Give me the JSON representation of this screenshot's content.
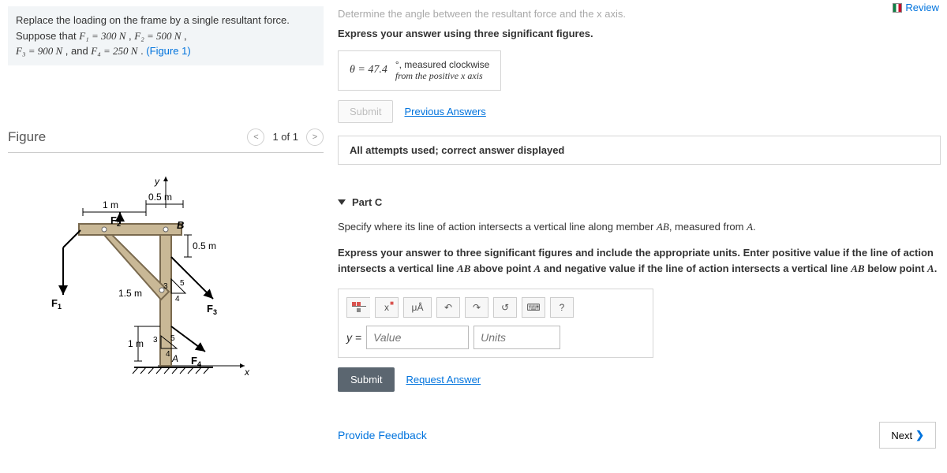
{
  "problem": {
    "text_a": "Replace the loading on the frame by a single resultant force. Suppose that ",
    "f1": "F₁ = 300  N",
    "comma": " ,",
    "f2": "F₂ = 500  N",
    "f3": "F₃ = 900  N",
    "and": " , and ",
    "f4": "F₄ = 250  N",
    "period": " . ",
    "fig_link": "(Figure 1)"
  },
  "figure": {
    "title": "Figure",
    "count": "1 of 1"
  },
  "review": "Review",
  "partB": {
    "faded_line": "Determine the angle between the resultant force and the x axis.",
    "instruction": "Express your answer using three significant figures.",
    "answer_lhs": "θ =  47.4",
    "answer_rhs1": "°, measured clockwise",
    "answer_rhs2": "from the positive x axis",
    "submit": "Submit",
    "prev": "Previous Answers",
    "status": "All attempts used; correct answer displayed"
  },
  "partC": {
    "heading": "Part C",
    "line1a": "Specify where its line of action intersects a vertical line along member ",
    "line1b": "AB",
    "line1c": ", measured from ",
    "line1d": "A",
    "line1e": ".",
    "instrA": "Express your answer to three significant figures and include the appropriate units. Enter positive value if the line of action intersects a vertical line ",
    "instrB": "AB",
    "instrC": " above point ",
    "instrD": "A",
    "instrE": " and negative value if the line of action intersects a vertical line ",
    "instrF": "AB",
    "instrG": " below point ",
    "instrH": "A",
    "instrI": ".",
    "mu": "μÅ",
    "help": "?",
    "y_lbl": "y = ",
    "val_ph": "Value",
    "unit_ph": "Units",
    "submit": "Submit",
    "request": "Request Answer"
  },
  "feedback": "Provide Feedback",
  "next": "Next"
}
